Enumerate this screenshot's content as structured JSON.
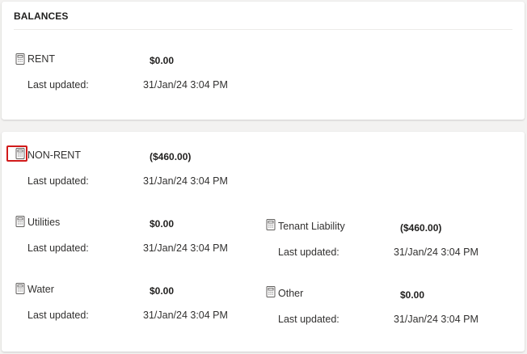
{
  "balances_section": {
    "title": "BALANCES",
    "rent": {
      "icon": "calculator-icon",
      "label": "RENT",
      "amount": "$0.00",
      "updated_label": "Last updated:",
      "updated_value": "31/Jan/24 3:04 PM"
    }
  },
  "nonrent_section": {
    "nonrent": {
      "icon": "calculator-icon",
      "label": "NON-RENT",
      "amount": "($460.00)",
      "updated_label": "Last updated:",
      "updated_value": "31/Jan/24 3:04 PM"
    },
    "utilities": {
      "icon": "calculator-icon",
      "label": "Utilities",
      "amount": "$0.00",
      "updated_label": "Last updated:",
      "updated_value": "31/Jan/24 3:04 PM"
    },
    "tenant_liability": {
      "icon": "calculator-icon",
      "label": "Tenant Liability",
      "amount": "($460.00)",
      "updated_label": "Last updated:",
      "updated_value": "31/Jan/24 3:04 PM"
    },
    "water": {
      "icon": "calculator-icon",
      "label": "Water",
      "amount": "$0.00",
      "updated_label": "Last updated:",
      "updated_value": "31/Jan/24 3:04 PM"
    },
    "other": {
      "icon": "calculator-icon",
      "label": "Other",
      "amount": "$0.00",
      "updated_label": "Last updated:",
      "updated_value": "31/Jan/24 3:04 PM"
    }
  },
  "colors": {
    "highlight": "#d11a1a",
    "card_background": "#ffffff",
    "page_background": "#f3f2f1"
  }
}
